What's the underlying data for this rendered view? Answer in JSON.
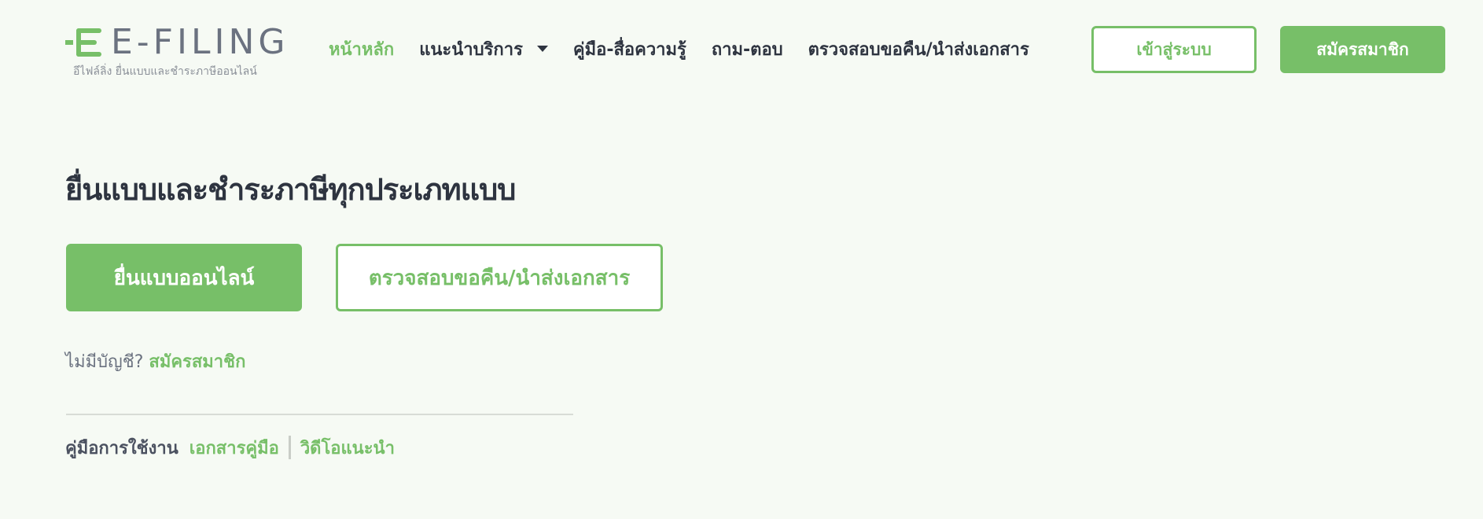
{
  "brand": {
    "logo_text": "E-FILING",
    "logo_subtitle": "อีไฟล์ลิ่ง ยื่นแบบและชำระภาษีออนไลน์",
    "accent_color": "#77bf68",
    "logo_icon": "efiling-logo-icon"
  },
  "nav": {
    "items": [
      {
        "label": "หน้าหลัก",
        "active": true
      },
      {
        "label": "แนะนำบริการ",
        "has_dropdown": true,
        "dropdown_icon": "chevron-down-icon"
      },
      {
        "label": "คู่มือ-สื่อความรู้"
      },
      {
        "label": "ถาม-ตอบ"
      },
      {
        "label": "ตรวจสอบขอคืน/นำส่งเอกสาร"
      }
    ]
  },
  "header_buttons": {
    "login": "เข้าสู่ระบบ",
    "register": "สมัครสมาชิก"
  },
  "hero": {
    "title": "ยื่นแบบและชำระภาษีทุกประเภทแบบ",
    "file_online_button": "ยื่นแบบออนไลน์",
    "check_refund_button": "ตรวจสอบขอคืน/นำส่งเอกสาร",
    "no_account_text": "ไม่มีบัญชี?",
    "register_link": "สมัครสมาชิก"
  },
  "manual": {
    "label": "คู่มือการใช้งาน",
    "document_link": "เอกสารคู่มือ",
    "video_link": "วิดีโอแนะนำ"
  }
}
